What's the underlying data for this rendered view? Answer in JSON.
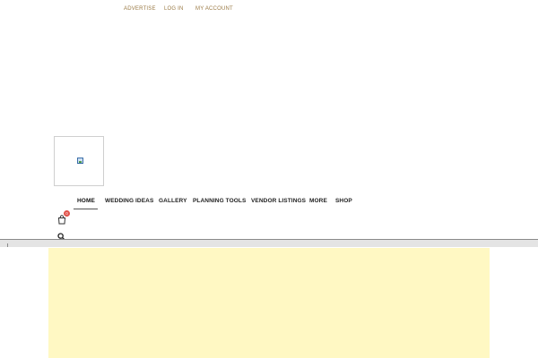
{
  "top_links": [
    "ADVERTISE",
    "LOG IN",
    "MY ACCOUNT"
  ],
  "nav": {
    "items": [
      "HOME",
      "WEDDING IDEAS",
      "GALLERY",
      "PLANNING TOOLS",
      "VENDOR LISTINGS",
      "MORE",
      "SHOP"
    ],
    "active": "HOME"
  },
  "cart": {
    "count": "0",
    "icon": "shopping-bag-icon"
  },
  "search": {
    "icon": "search-icon"
  },
  "logo": {
    "icon": "broken-image-icon"
  },
  "colors": {
    "top_link": "#9a7a45",
    "nav_text": "#222222",
    "cart_badge": "#e0524a",
    "content_panel": "#fff8c3",
    "divider": "#e4e4e4"
  }
}
